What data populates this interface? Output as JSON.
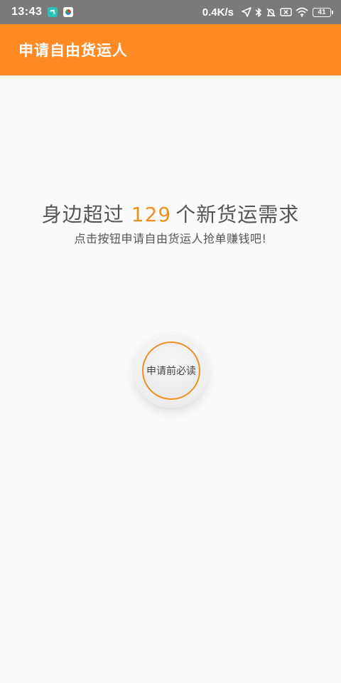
{
  "status_bar": {
    "time": "13:43",
    "network_speed": "0.4K/s",
    "battery_level": "41",
    "icons": [
      "location-arrow-icon",
      "bluetooth-icon",
      "mute-bell-icon",
      "no-sim-icon",
      "wifi-icon",
      "battery-icon"
    ]
  },
  "app_bar": {
    "title": "申请自由货运人",
    "color": "#ff8a24"
  },
  "main": {
    "headline_prefix": "身边超过",
    "headline_count": "129",
    "headline_suffix": "个新货运需求",
    "subline": "点击按钮申请自由货运人抢单赚钱吧!",
    "accent_color": "#f0901e",
    "read_button_label": "申请前必读"
  }
}
